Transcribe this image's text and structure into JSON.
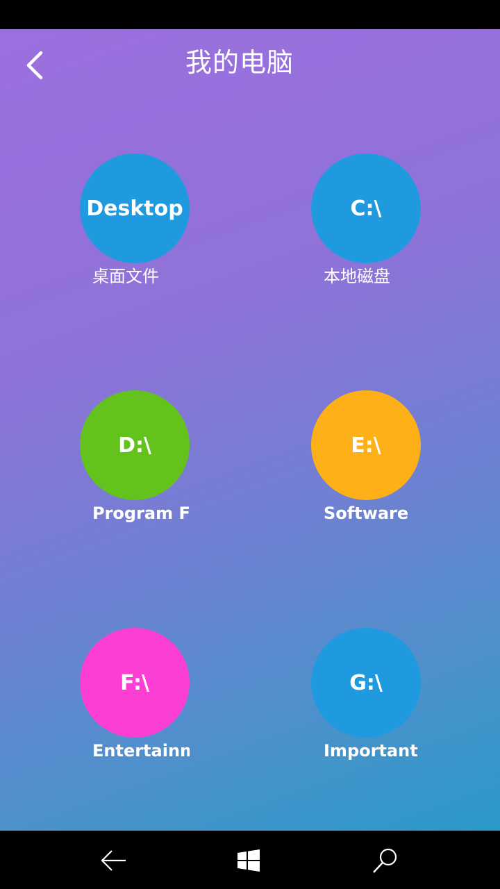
{
  "header": {
    "title": "我的电脑",
    "back_icon": "chevron-left-icon"
  },
  "drives": [
    {
      "circle_text": "Desktop",
      "label": "桌面文件",
      "color": "#1f9ade"
    },
    {
      "circle_text": "C:\\",
      "label": "本地磁盘",
      "color": "#1f9ade"
    },
    {
      "circle_text": "D:\\",
      "label": "Program Fil",
      "color": "#64c21c"
    },
    {
      "circle_text": "E:\\",
      "label": "Software",
      "color": "#fdb017"
    },
    {
      "circle_text": "F:\\",
      "label": "Entertainm",
      "color": "#fc3fd4"
    },
    {
      "circle_text": "G:\\",
      "label": "Important d",
      "color": "#1f9ade"
    }
  ],
  "nav": {
    "back_icon": "arrow-left-icon",
    "home_icon": "windows-logo-icon",
    "search_icon": "search-icon"
  }
}
